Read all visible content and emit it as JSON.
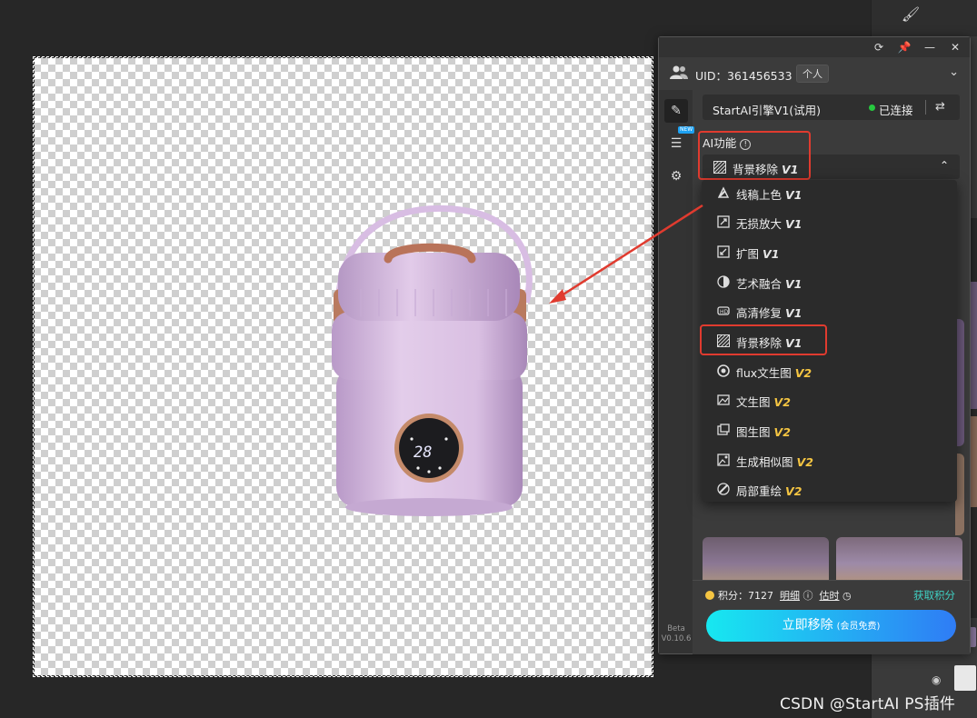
{
  "panel": {
    "uid_text": "UID：361456533",
    "account_type": "个人",
    "engine_name": "StartAI引擎V1(试用)",
    "connection_status": "已连接",
    "ai_section_label": "AI功能",
    "selected": {
      "label": "背景移除",
      "version": "V1"
    },
    "menu": [
      {
        "label": "线稿上色",
        "version": "V1",
        "icon": "lineart-color-icon"
      },
      {
        "label": "无损放大",
        "version": "V1",
        "icon": "upscale-icon"
      },
      {
        "label": "扩图",
        "version": "V1",
        "icon": "expand-image-icon"
      },
      {
        "label": "艺术融合",
        "version": "V1",
        "icon": "art-fusion-icon"
      },
      {
        "label": "高清修复",
        "version": "V1",
        "icon": "hd-repair-icon"
      },
      {
        "label": "背景移除",
        "version": "V1",
        "icon": "background-remove-icon"
      },
      {
        "label": "flux文生图",
        "version": "V2",
        "icon": "flux-icon"
      },
      {
        "label": "文生图",
        "version": "V2",
        "icon": "text-to-image-icon"
      },
      {
        "label": "图生图",
        "version": "V2",
        "icon": "image-to-image-icon"
      },
      {
        "label": "生成相似图",
        "version": "V2",
        "icon": "similar-image-icon"
      },
      {
        "label": "局部重绘",
        "version": "V2",
        "icon": "inpaint-icon"
      }
    ],
    "points_label": "积分：",
    "points_value": "7127",
    "detail_link": "明细",
    "estimate_link": "估时",
    "get_points": "获取积分",
    "cta_label": "立即移除",
    "cta_note": "(会员免费)",
    "version_beta": "Beta",
    "version_number": "V0.10.6",
    "new_badge": "NEW"
  },
  "watermark": "CSDN @StartAI PS插件",
  "colors": {
    "accent_red": "#e03b2f",
    "connected": "#27c93f",
    "v2_gold": "#f5c542",
    "cta_start": "#17e8f0",
    "cta_end": "#2f7cf5"
  }
}
